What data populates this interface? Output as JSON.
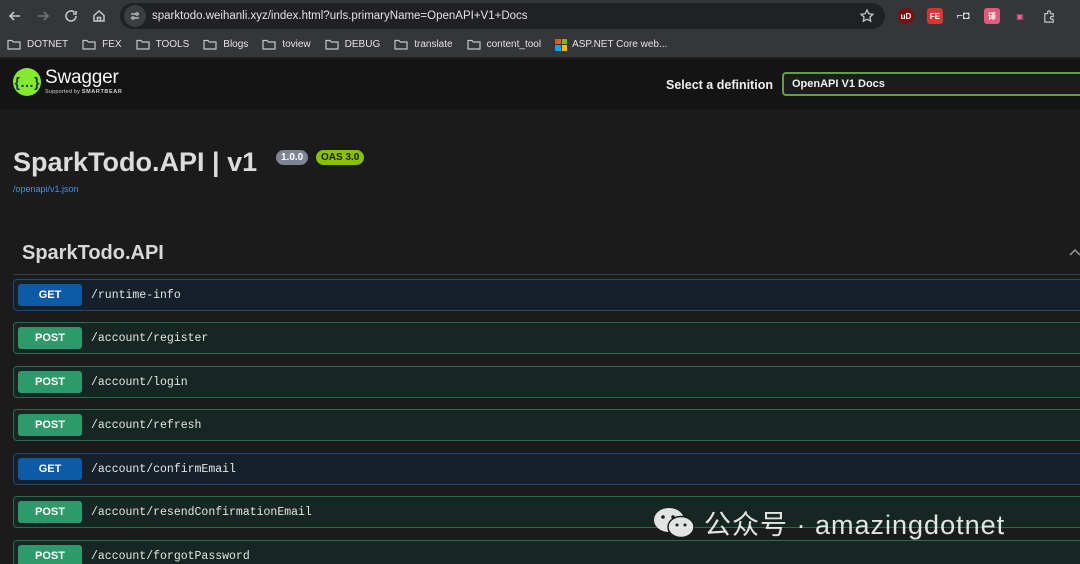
{
  "browser": {
    "url": "sparktodo.weihanli.xyz/index.html?urls.primaryName=OpenAPI+V1+Docs",
    "icons": [
      "back-icon",
      "forward-icon",
      "reload-icon",
      "home-icon",
      "site-info-icon",
      "bookmark-star-icon"
    ],
    "extensions": [
      {
        "name": "ublock-extension-icon",
        "label": "uD"
      },
      {
        "name": "fe-extension-icon",
        "label": "FE"
      },
      {
        "name": "glasses-extension-icon",
        "label": "⌐◘"
      },
      {
        "name": "translate-extension-icon",
        "label": "译"
      },
      {
        "name": "tv-extension-icon",
        "label": "▣"
      },
      {
        "name": "extensions-puzzle-icon",
        "label": ""
      }
    ]
  },
  "bookmarks": [
    {
      "label": "DOTNET",
      "icon": "folder-icon"
    },
    {
      "label": "FEX",
      "icon": "folder-icon"
    },
    {
      "label": "TOOLS",
      "icon": "folder-icon"
    },
    {
      "label": "Blogs",
      "icon": "folder-icon"
    },
    {
      "label": "toview",
      "icon": "folder-icon"
    },
    {
      "label": "DEBUG",
      "icon": "folder-icon"
    },
    {
      "label": "translate",
      "icon": "folder-icon"
    },
    {
      "label": "content_tool",
      "icon": "folder-icon"
    },
    {
      "label": "ASP.NET Core web...",
      "icon": "microsoft-icon"
    }
  ],
  "swagger": {
    "logo_title": "Swagger",
    "logo_sub_prefix": "Supported by",
    "logo_sub_brand": "SMARTBEAR",
    "select_label": "Select a definition",
    "selected_definition": "OpenAPI V1 Docs"
  },
  "info": {
    "title": "SparkTodo.API | v1",
    "version_badge": "1.0.0",
    "oas_badge": "OAS 3.0",
    "spec_link": "/openapi/v1.json"
  },
  "tag": {
    "name": "SparkTodo.API"
  },
  "operations": [
    {
      "method": "GET",
      "path": "/runtime-info"
    },
    {
      "method": "POST",
      "path": "/account/register"
    },
    {
      "method": "POST",
      "path": "/account/login"
    },
    {
      "method": "POST",
      "path": "/account/refresh"
    },
    {
      "method": "GET",
      "path": "/account/confirmEmail"
    },
    {
      "method": "POST",
      "path": "/account/resendConfirmationEmail"
    },
    {
      "method": "POST",
      "path": "/account/forgotPassword"
    }
  ],
  "watermark": {
    "text": "公众号 · amazingdotnet"
  },
  "colors": {
    "get": "#0d5aa7",
    "post": "#2e9a6c",
    "swagger_green": "#85ea2d",
    "link": "#4990e2",
    "oas_badge": "#89bf04"
  }
}
